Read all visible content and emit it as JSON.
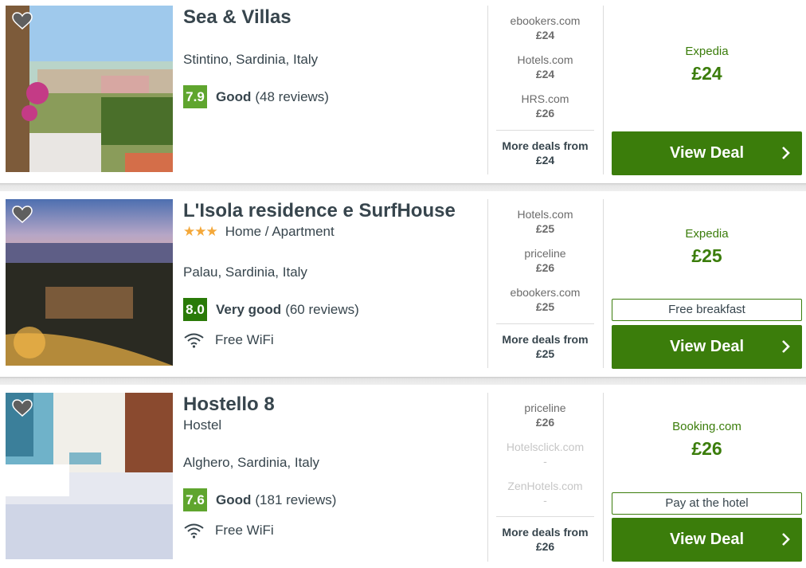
{
  "hotels": [
    {
      "name": "Sea & Villas",
      "stars": "",
      "type": "",
      "location": "Stintino, Sardinia, Italy",
      "score": "7.9",
      "score_color": "#5fa52e",
      "rating_word": "Good",
      "reviews": "(48 reviews)",
      "amenity": "",
      "deals": [
        {
          "site": "ebookers.com",
          "price": "£24"
        },
        {
          "site": "Hotels.com",
          "price": "£24"
        },
        {
          "site": "HRS.com",
          "price": "£26"
        }
      ],
      "more_label": "More deals from",
      "more_price": "£24",
      "best_site": "Expedia",
      "best_price": "£24",
      "tag": "",
      "button": "View Deal"
    },
    {
      "name": "L'Isola residence e SurfHouse",
      "stars": "★★★",
      "type": "Home / Apartment",
      "location": "Palau, Sardinia, Italy",
      "score": "8.0",
      "score_color": "#2a7a08",
      "rating_word": "Very good",
      "reviews": "(60 reviews)",
      "amenity": "Free WiFi",
      "deals": [
        {
          "site": "Hotels.com",
          "price": "£25"
        },
        {
          "site": "priceline",
          "price": "£26"
        },
        {
          "site": "ebookers.com",
          "price": "£25"
        }
      ],
      "more_label": "More deals from",
      "more_price": "£25",
      "best_site": "Expedia",
      "best_price": "£25",
      "tag": "Free breakfast",
      "button": "View Deal"
    },
    {
      "name": "Hostello 8",
      "stars": "",
      "type": "Hostel",
      "location": "Alghero, Sardinia, Italy",
      "score": "7.6",
      "score_color": "#5fa52e",
      "rating_word": "Good",
      "reviews": "(181 reviews)",
      "amenity": "Free WiFi",
      "deals": [
        {
          "site": "priceline",
          "price": "£26"
        },
        {
          "site": "Hotelsclick.com",
          "price": "-"
        },
        {
          "site": "ZenHotels.com",
          "price": "-"
        }
      ],
      "more_label": "More deals from",
      "more_price": "£26",
      "best_site": "Booking.com",
      "best_price": "£26",
      "tag": "Pay at the hotel",
      "button": "View Deal"
    }
  ]
}
